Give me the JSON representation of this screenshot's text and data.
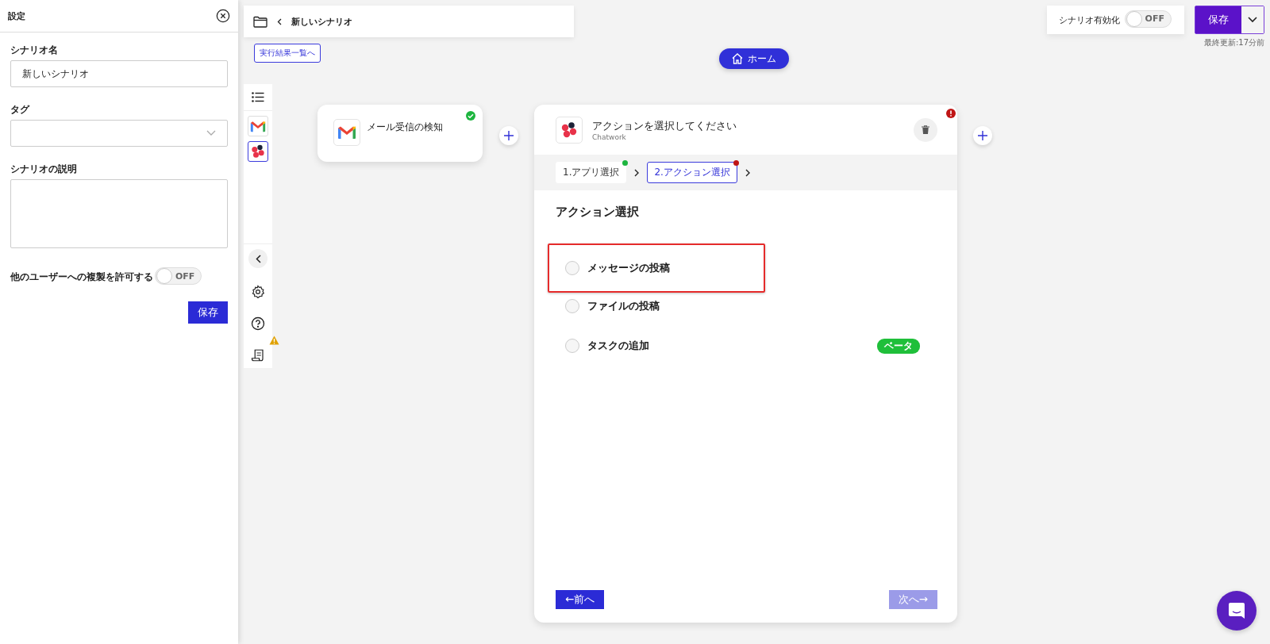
{
  "settings_panel": {
    "title": "設定",
    "fields": [
      {
        "label": "シナリオ名",
        "kind": "text",
        "value": "新しいシナリオ"
      },
      {
        "label": "タグ",
        "kind": "select"
      },
      {
        "label": "シナリオの説明",
        "kind": "textarea"
      }
    ],
    "copy_permission": {
      "label": "他のユーザーへの複製を許可する",
      "toggle_text": "OFF",
      "on": false
    },
    "save_button": "保存"
  },
  "header": {
    "scenario_name": "新しいシナリオ",
    "results_link": "実行結果一覧へ",
    "home_button": "ホーム",
    "enable": {
      "label": "シナリオ有効化",
      "toggle_text": "OFF",
      "on": false
    },
    "save_button": "保存",
    "last_updated": "最終更新:17分前"
  },
  "sidebar_apps": [
    {
      "kind": "gmail",
      "selected": false
    },
    {
      "kind": "chatwork",
      "selected": true
    }
  ],
  "sidebar_tools": [
    {
      "kind": "settings",
      "warning": false
    },
    {
      "kind": "help",
      "warning": false
    },
    {
      "kind": "log",
      "warning": true
    }
  ],
  "trigger": {
    "title": "メール受信の検知",
    "kind": "gmail",
    "complete": true
  },
  "action": {
    "title": "アクションを選択してください",
    "app_name": "Chatwork",
    "kind": "chatwork",
    "error": true,
    "steps": [
      {
        "label": "1.アプリ選択",
        "selected": false,
        "complete": true
      },
      {
        "label": "2.アクション選択",
        "selected": true,
        "complete": false
      }
    ],
    "section_title": "アクション選択",
    "options": [
      {
        "label": "メッセージの投稿",
        "selected": false,
        "highlighted": true
      },
      {
        "label": "ファイルの投稿",
        "selected": false,
        "highlighted": false
      },
      {
        "label": "タスクの追加",
        "selected": false,
        "highlighted": false,
        "badge": "ベータ"
      }
    ],
    "prev_button": "←前へ",
    "next_button": "次へ→",
    "next_disabled": true
  }
}
